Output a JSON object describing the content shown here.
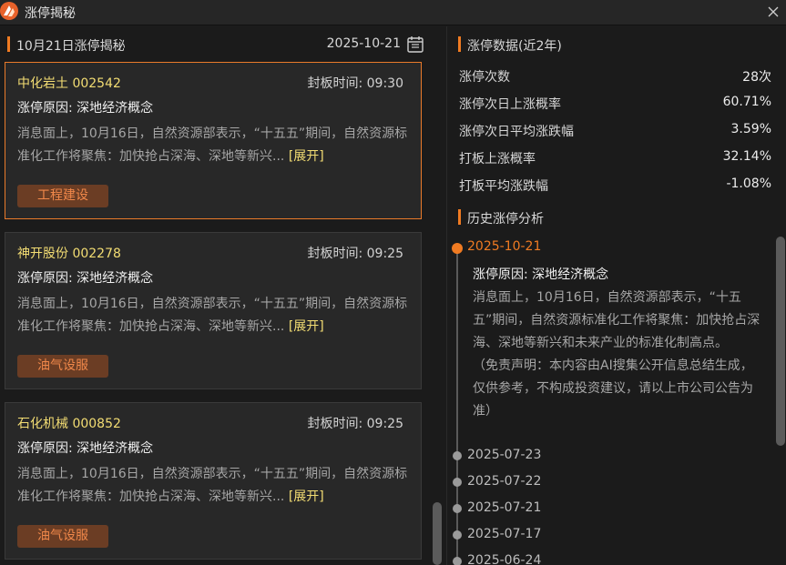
{
  "window": {
    "title": "涨停揭秘"
  },
  "left": {
    "section_title": "10月21日涨停揭秘",
    "date": "2025-10-21",
    "cards": [
      {
        "stock": "中化岩土 002542",
        "seal_time": "封板时间: 09:30",
        "reason": "涨停原因: 深地经济概念",
        "desc": "消息面上，10月16日，自然资源部表示，“十五五”期间，自然资源标准化工作将聚焦：加快抢占深海、深地等新兴...",
        "expand": "[展开]",
        "tag": "工程建设"
      },
      {
        "stock": "神开股份 002278",
        "seal_time": "封板时间: 09:25",
        "reason": "涨停原因: 深地经济概念",
        "desc": "消息面上，10月16日，自然资源部表示，“十五五”期间，自然资源标准化工作将聚焦：加快抢占深海、深地等新兴...",
        "expand": "[展开]",
        "tag": "油气设服"
      },
      {
        "stock": "石化机械 000852",
        "seal_time": "封板时间: 09:25",
        "reason": "涨停原因: 深地经济概念",
        "desc": "消息面上，10月16日，自然资源部表示，“十五五”期间，自然资源标准化工作将聚焦：加快抢占深海、深地等新兴...",
        "expand": "[展开]",
        "tag": "油气设服"
      }
    ]
  },
  "right": {
    "stats_title": "涨停数据(近2年)",
    "stats": [
      {
        "label": "涨停次数",
        "value": "28次"
      },
      {
        "label": "涨停次日上涨概率",
        "value": "60.71%"
      },
      {
        "label": "涨停次日平均涨跌幅",
        "value": "3.59%"
      },
      {
        "label": "打板上涨概率",
        "value": "32.14%"
      },
      {
        "label": "打板平均涨跌幅",
        "value": "-1.08%"
      }
    ],
    "history_title": "历史涨停分析",
    "history": {
      "active_date": "2025-10-21",
      "reason": "涨停原因: 深地经济概念",
      "desc": "消息面上，10月16日，自然资源部表示，“十五五”期间，自然资源标准化工作将聚焦：加快抢占深海、深地等新兴和未来产业的标准化制高点。",
      "disclaimer": "（免责声明：本内容由AI搜集公开信息总结生成，仅供参考，不构成投资建议，请以上市公司公告为准）",
      "dates": [
        "2025-07-23",
        "2025-07-22",
        "2025-07-21",
        "2025-07-17",
        "2025-06-24"
      ]
    }
  },
  "colors": {
    "accent": "#f07b22",
    "stock_name": "#f3dd73",
    "tag_bg": "#6b3d24"
  },
  "icons": {
    "logo": "app-logo-icon",
    "close": "close-icon",
    "calendar": "calendar-icon"
  }
}
